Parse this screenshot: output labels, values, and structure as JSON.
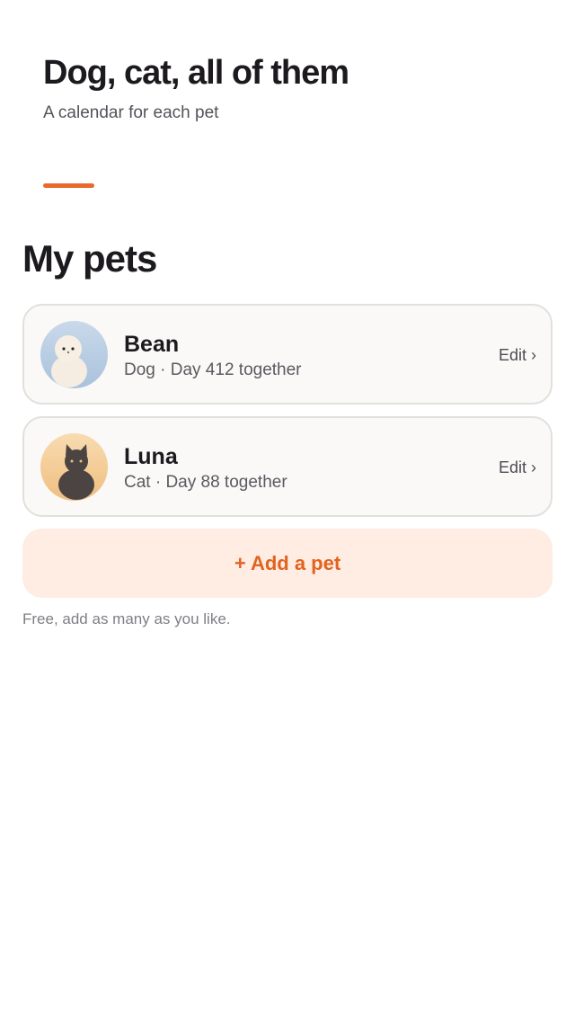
{
  "hero": {
    "title": "Dog, cat, all of them",
    "subtitle": "A calendar for each pet"
  },
  "section": {
    "title": "My pets"
  },
  "pets": [
    {
      "name": "Bean",
      "meta": "Dog · Day 412 together",
      "edit_label": "Edit ›",
      "avatar_icon": "dog-icon"
    },
    {
      "name": "Luna",
      "meta": "Cat · Day 88 together",
      "edit_label": "Edit ›",
      "avatar_icon": "cat-icon"
    }
  ],
  "add_button": {
    "label": "+ Add a pet"
  },
  "footnote": "Free, add as many as you like.",
  "colors": {
    "accent": "#e8692a",
    "add_button_bg": "#ffece2",
    "card_bg": "#faf9f7",
    "card_border": "#e2e0dd"
  }
}
